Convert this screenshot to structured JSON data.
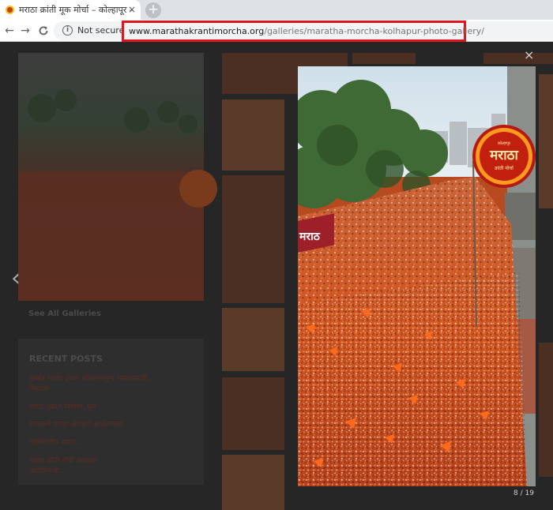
{
  "browser": {
    "tab": {
      "title": "मराठा क्रांती मूक मोर्चा – कोल्हापूर - M",
      "close_glyph": "×"
    },
    "new_tab_glyph": "+",
    "nav": {
      "back": "←",
      "forward": "→",
      "reload": "C"
    },
    "omnibox": {
      "security_label": "Not secure",
      "url_domain": "www.marathakrantimorcha.org",
      "url_path": "/galleries/maratha-morcha-kolhapur-photo-gallery/"
    }
  },
  "page": {
    "see_all": "See All Galleries",
    "recent_posts_heading": "RECENT POSTS",
    "recent_posts": [
      "मुंबईत मराठा दुकान सोडलानाहुना समाजासाठी...",
      "मिळाला",
      "मराठा दुकान मोर्चाचा, पुणे",
      "सरकारने मराठा आरक्षण आंदोलनाचा...",
      "गडचिरोलीत मराठा...",
      "मराठा क्रांती मोर्चा आरक्षण",
      "आंदोलनाचा..."
    ]
  },
  "lightbox": {
    "close_glyph": "×",
    "prev_glyph": "‹",
    "counter": "8 / 19",
    "banner_left": "मराठ",
    "badge_main": "मराठा",
    "badge_sub": "क्रांती मोर्चा",
    "badge_small": "कोल्हापूर"
  },
  "colors": {
    "url_highlight_border": "#e0151e",
    "crowd_saffron": "#e0621f"
  }
}
